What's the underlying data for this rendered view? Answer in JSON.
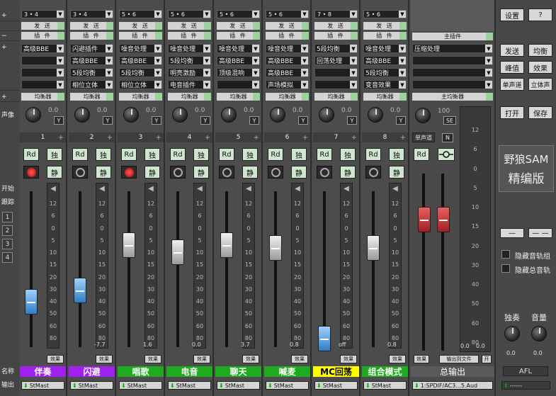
{
  "left": {
    "plus_top": "+",
    "blank": "",
    "minus": "−",
    "plus_fx": "+",
    "plus_eq": "+",
    "pan_label": "声像",
    "start_label": "开始",
    "track_label": "跟踪",
    "track_btns": [
      "1",
      "2",
      "3",
      "4"
    ],
    "name_label": "名称",
    "out_label": "输出"
  },
  "strips": [
    {
      "num": "1",
      "route": "3 • 4",
      "send": "发 送",
      "plugin": "插 件",
      "fx": [
        "高级BBE",
        "",
        "",
        ""
      ],
      "eq": "均衡器",
      "pan": "0.0",
      "rec": "red",
      "val": "",
      "fader": 0.26,
      "name": "伴奏",
      "name_bg": "#a020f0",
      "name_fg": "#ffffff",
      "out": "StMast"
    },
    {
      "num": "2",
      "route": "3 • 4",
      "send": "发 送",
      "plugin": "插 件",
      "fx": [
        "闪避插件",
        "高级BBE",
        "5段均衡",
        "相位立体"
      ],
      "eq": "均衡器",
      "pan": "0.0",
      "rec": "off",
      "val": "-7.7",
      "fader": 0.34,
      "name": "闪避",
      "name_bg": "#a020f0",
      "name_fg": "#ffffff",
      "out": "StMast"
    },
    {
      "num": "3",
      "route": "5 • 6",
      "send": "发 送",
      "plugin": "插 件",
      "fx": [
        "噪音处理",
        "高级BBE",
        "5段均衡",
        "相位立体"
      ],
      "eq": "均衡器",
      "pan": "0.0",
      "rec": "red",
      "val": "1.6",
      "fader": 0.66,
      "name": "唱歌",
      "name_bg": "#1faa1f",
      "name_fg": "#ffffff",
      "out": "StMast"
    },
    {
      "num": "4",
      "route": "5 • 6",
      "send": "发 送",
      "plugin": "插 件",
      "fx": [
        "噪音处理",
        "5段均衡",
        "明亮激励",
        "电音插件"
      ],
      "eq": "均衡器",
      "pan": "0.0",
      "rec": "off",
      "val": "0.0",
      "fader": 0.61,
      "name": "电音",
      "name_bg": "#1faa1f",
      "name_fg": "#ffffff",
      "out": "StMast"
    },
    {
      "num": "5",
      "route": "5 • 6",
      "send": "发 送",
      "plugin": "插 件",
      "fx": [
        "噪音处理",
        "高级BBE",
        "顶级混响",
        ""
      ],
      "eq": "均衡器",
      "pan": "0.0",
      "rec": "off",
      "val": "3.7",
      "fader": 0.66,
      "name": "聊天",
      "name_bg": "#1faa1f",
      "name_fg": "#ffffff",
      "out": "StMast"
    },
    {
      "num": "6",
      "route": "5 • 6",
      "send": "发 送",
      "plugin": "插 件",
      "fx": [
        "噪音处理",
        "高级BBE",
        "高级BBE",
        "声场模拟"
      ],
      "eq": "均衡器",
      "pan": "0.0",
      "rec": "off",
      "val": "0.8",
      "fader": 0.64,
      "name": "喊麦",
      "name_bg": "#1faa1f",
      "name_fg": "#ffffff",
      "out": "StMast"
    },
    {
      "num": "7",
      "route": "7 • 8",
      "send": "发 送",
      "plugin": "插 件",
      "fx": [
        "5段均衡",
        "回荡处理",
        "",
        ""
      ],
      "eq": "均衡器",
      "pan": "0.0",
      "rec": "off",
      "val": "off",
      "fader": 0.0,
      "name": "MC回荡",
      "name_bg": "#ffff00",
      "name_fg": "#000000",
      "out": "StMast"
    },
    {
      "num": "8",
      "route": "5 • 6",
      "send": "发 送",
      "plugin": "插 件",
      "fx": [
        "噪音处理",
        "高级BBE",
        "5段均衡",
        "变音效果"
      ],
      "eq": "均衡器",
      "pan": "0.0",
      "rec": "off",
      "val": "0.8",
      "fader": 0.64,
      "name": "组合模式",
      "name_bg": "#1faa1f",
      "name_fg": "#ffffff",
      "out": "StMast"
    }
  ],
  "master": {
    "plugin": "主插件",
    "fx": [
      "压缩处理",
      "",
      "",
      ""
    ],
    "eq": "主均衡器",
    "vol": "100",
    "se": "SE",
    "mono": "单声道",
    "n": "N",
    "rd": "Rd",
    "fx_btn": "效果",
    "export": "输出到文件",
    "open_small": "开",
    "name": "总输出",
    "out": "1:SPDIF/AC3...5.Aud",
    "val_l": "0.0",
    "val_r": "0.0",
    "fader": 0.74
  },
  "scale": [
    "12",
    "6",
    "0",
    "5",
    "10",
    "15",
    "20",
    "30",
    "40",
    "50",
    "60",
    "80"
  ],
  "common": {
    "rd": "Rd",
    "solo": "独",
    "mute": "静",
    "y": "Y",
    "fx": "效果",
    "plus": "+",
    "arrow": "▼"
  },
  "right": {
    "settings": "设置",
    "help": "?",
    "send": "发送",
    "eq": "均衡",
    "peak": "峰值",
    "effect": "效果",
    "mono": "单声道",
    "stereo": "立体声",
    "open": "打开",
    "save": "保存",
    "brand1": "野狼SAM",
    "brand2": "精编版",
    "dash1": "—",
    "dash2": "— —",
    "hide_group": "隐藏音轨组",
    "hide_master": "隐藏总音轨",
    "solo_label": "独奏",
    "vol_label": "音量",
    "solo_val": "0.0",
    "vol_val": "0.0",
    "afl": "AFL",
    "down": "------"
  }
}
